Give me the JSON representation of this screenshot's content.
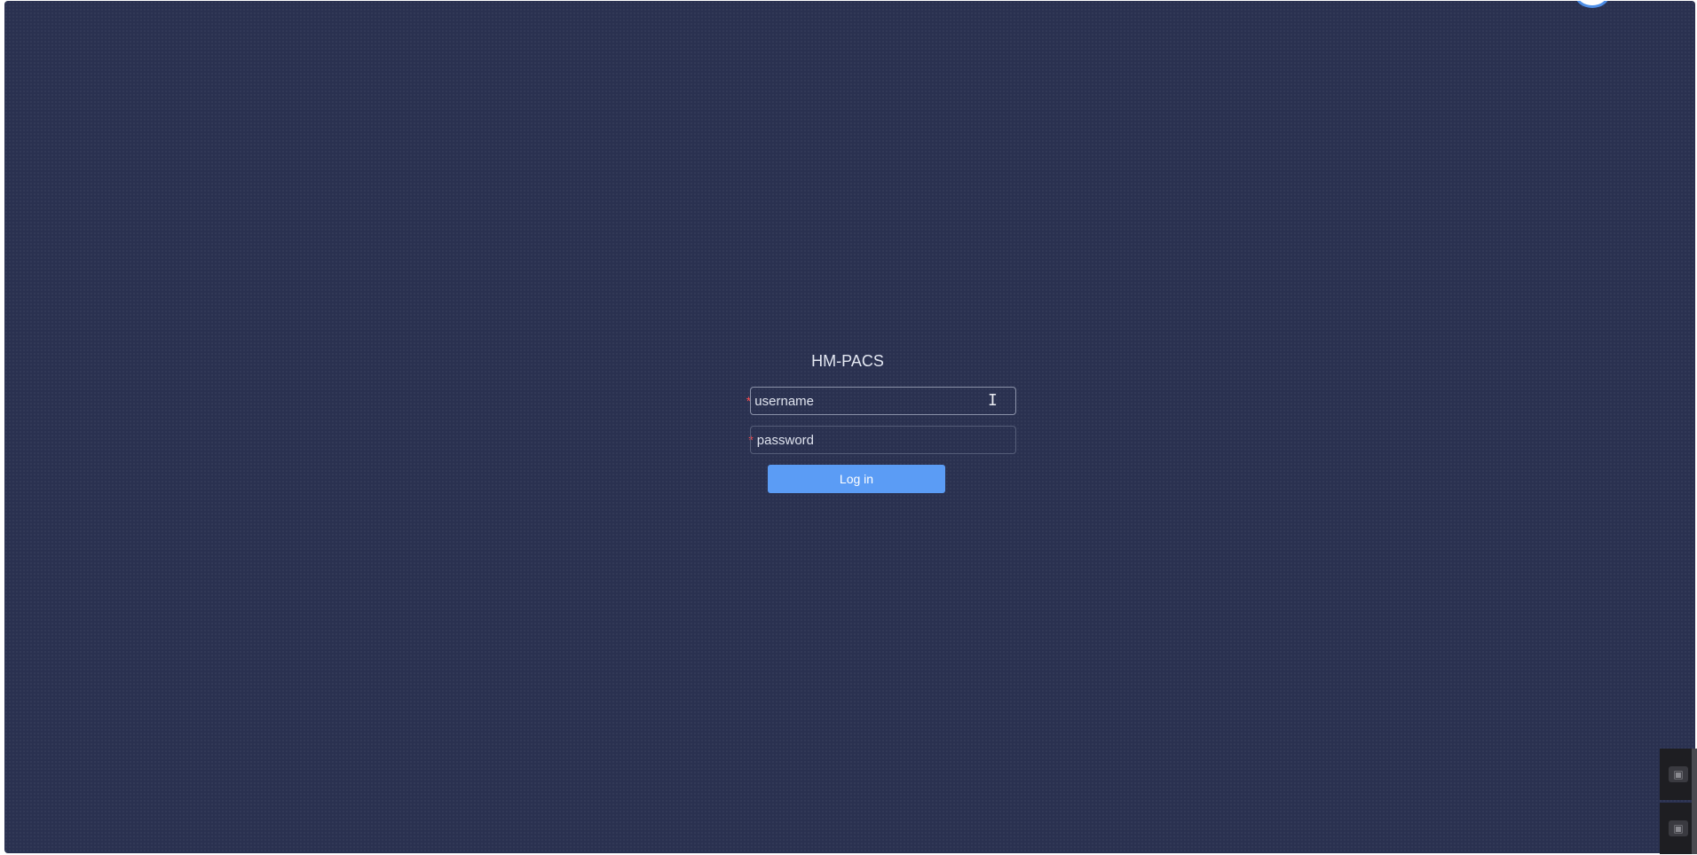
{
  "app": {
    "title": "HM-PACS"
  },
  "form": {
    "username": {
      "required_mark": "*",
      "label": "username",
      "value": "",
      "placeholder": ""
    },
    "password": {
      "required_mark": "*",
      "label": "password",
      "value": "",
      "placeholder": ""
    },
    "submit_label": "Log in"
  },
  "icons": {
    "text_cursor": "text-cursor-icon",
    "side_widget": "image-icon"
  },
  "colors": {
    "background": "#2a3150",
    "primary_button": "#5b9cf5",
    "required": "#ff4d4f"
  }
}
